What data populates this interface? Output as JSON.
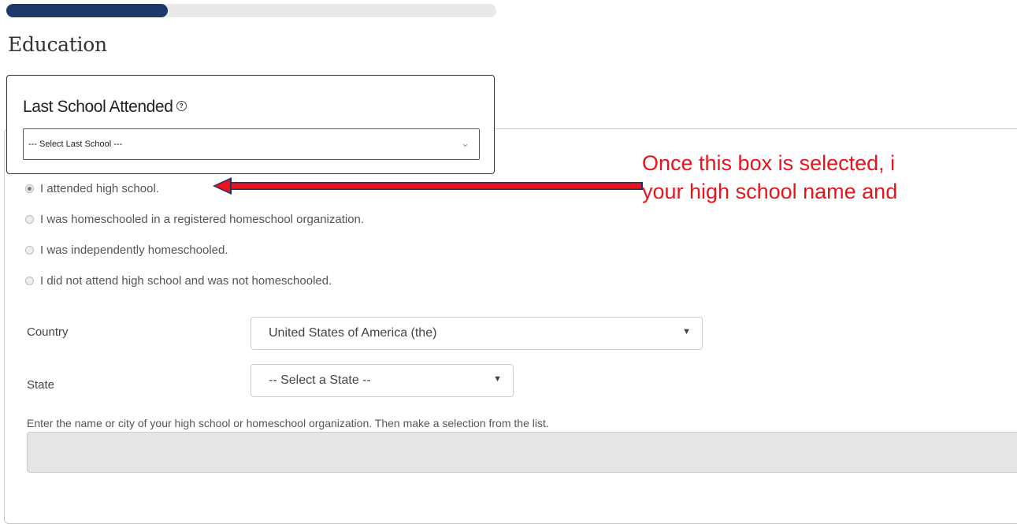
{
  "progress": {
    "fraction": 0.33
  },
  "page": {
    "title": "Education"
  },
  "last_school": {
    "heading": "Last School Attended",
    "help_icon": "help-circle-icon",
    "selected": "--- Select Last School ---"
  },
  "radio_options": [
    {
      "label": "I attended high school.",
      "checked": true
    },
    {
      "label": "I was homeschooled in a registered homeschool organization.",
      "checked": false
    },
    {
      "label": "I was independently homeschooled.",
      "checked": false
    },
    {
      "label": "I did not attend high school and was not homeschooled.",
      "checked": false
    }
  ],
  "country": {
    "label": "Country",
    "selected": "United States of America (the)"
  },
  "state": {
    "label": "State",
    "selected": "-- Select a State --"
  },
  "school_search": {
    "instructions": "Enter the name or city of your high school or homeschool organization. Then make a selection from the list.",
    "value": ""
  },
  "annotation": {
    "line1": "Once this box is selected, i",
    "line2": "your high school name and",
    "color": "#e8141c"
  }
}
